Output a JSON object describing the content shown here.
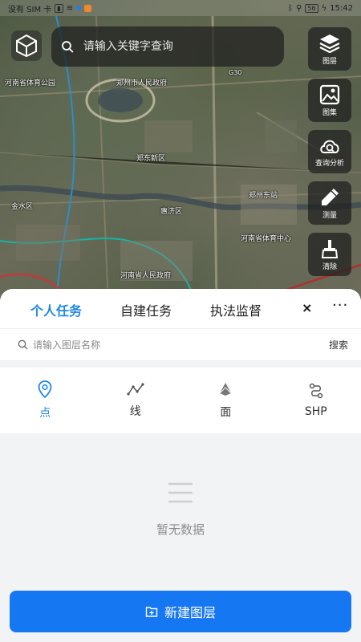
{
  "status_bar": {
    "carrier": "没有 SIM 卡",
    "time": "15:42",
    "battery": "56"
  },
  "map": {
    "search_placeholder": "请输入关键字查询",
    "labels": [
      "河南省体育公园",
      "郑州市人民政府",
      "郑州东站",
      "郑东新区",
      "金水区",
      "惠济区",
      "河南省人民政府",
      "河南省体育中心"
    ],
    "road_label": "G30"
  },
  "tools": [
    {
      "label": "图层",
      "icon": "layers-icon"
    },
    {
      "label": "图集",
      "icon": "gallery-icon"
    },
    {
      "label": "查询分析",
      "icon": "query-analysis-icon"
    },
    {
      "label": "测量",
      "icon": "measure-icon"
    },
    {
      "label": "清除",
      "icon": "clear-icon"
    }
  ],
  "sheet": {
    "tabs": [
      "个人任务",
      "自建任务",
      "执法监督"
    ],
    "active_tab": 0,
    "close_label": "×",
    "more_label": "···",
    "layer_search_placeholder": "请输入图层名称",
    "search_button": "搜索",
    "geometry_types": [
      "点",
      "线",
      "面",
      "SHP"
    ],
    "active_type": 0,
    "empty_text": "暂无数据",
    "new_layer_button": "新建图层"
  },
  "colors": {
    "accent": "#1e88e5",
    "primary_button": "#1677f2"
  }
}
